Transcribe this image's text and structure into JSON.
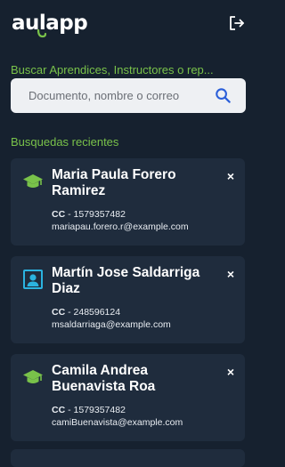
{
  "header": {
    "logo_text": "aulapp",
    "logout_icon": "logout-icon"
  },
  "search": {
    "label": "Buscar Aprendices, Instructores o rep...",
    "placeholder": "Documento, nombre o correo",
    "icon": "search-icon"
  },
  "recent": {
    "label": "Busquedas recientes",
    "items": [
      {
        "name": "Maria Paula Forero Ramirez",
        "id_type": "CC",
        "id_sep": " - ",
        "id_number": "1579357482",
        "email": "mariapau.forero.r@example.com",
        "icon": "graduation-cap-icon",
        "close_label": "×"
      },
      {
        "name": "Martín Jose Saldarriga Diaz",
        "id_type": "CC",
        "id_sep": " - ",
        "id_number": "248596124",
        "email": "msaldarriaga@example.com",
        "icon": "instructor-board-icon",
        "close_label": "×"
      },
      {
        "name": "Camila Andrea Buenavista Roa",
        "id_type": "CC",
        "id_sep": " - ",
        "id_number": "1579357482",
        "email": "camiBuenavista@example.com",
        "icon": "graduation-cap-icon",
        "close_label": "×"
      }
    ]
  },
  "colors": {
    "background": "#16212f",
    "card": "#1f2c3d",
    "accent_green": "#79c24a",
    "accent_blue": "#2bb3e0",
    "search_icon": "#2b5fd9"
  }
}
